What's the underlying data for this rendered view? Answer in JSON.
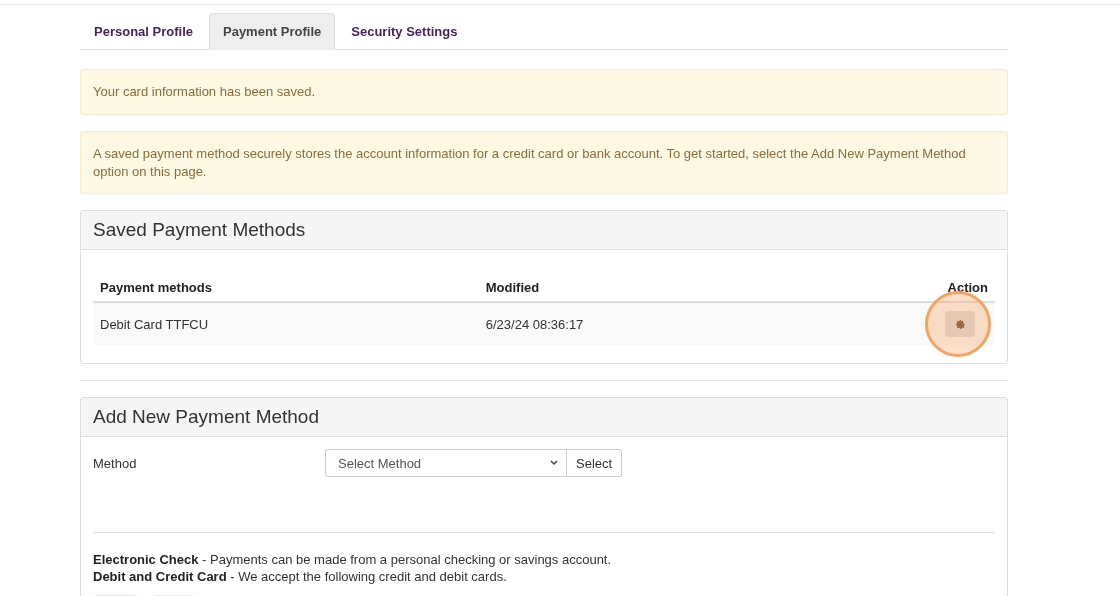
{
  "tabs": [
    {
      "label": "Personal Profile",
      "selected": false
    },
    {
      "label": "Payment Profile",
      "selected": true
    },
    {
      "label": "Security Settings",
      "selected": false
    }
  ],
  "alerts": [
    "Your card information has been saved.",
    "A saved payment method securely stores the account information for a credit card or bank account. To get started, select the Add New Payment Method option on this page."
  ],
  "saved_methods": {
    "title": "Saved Payment Methods",
    "columns": [
      "Payment methods",
      "Modified",
      "Action"
    ],
    "rows": [
      {
        "name": "Debit Card TTFCU",
        "modified": "6/23/24 08:36:17",
        "highlighted": true
      }
    ]
  },
  "add_method": {
    "title": "Add New Payment Method",
    "label": "Method",
    "select_value": "Select Method",
    "button": "Select",
    "notes": [
      "**Electronic Check** - Payments can be made from a personal checking or savings account.",
      "**Debit and Credit Card** - We accept the following credit and debit cards."
    ]
  }
}
